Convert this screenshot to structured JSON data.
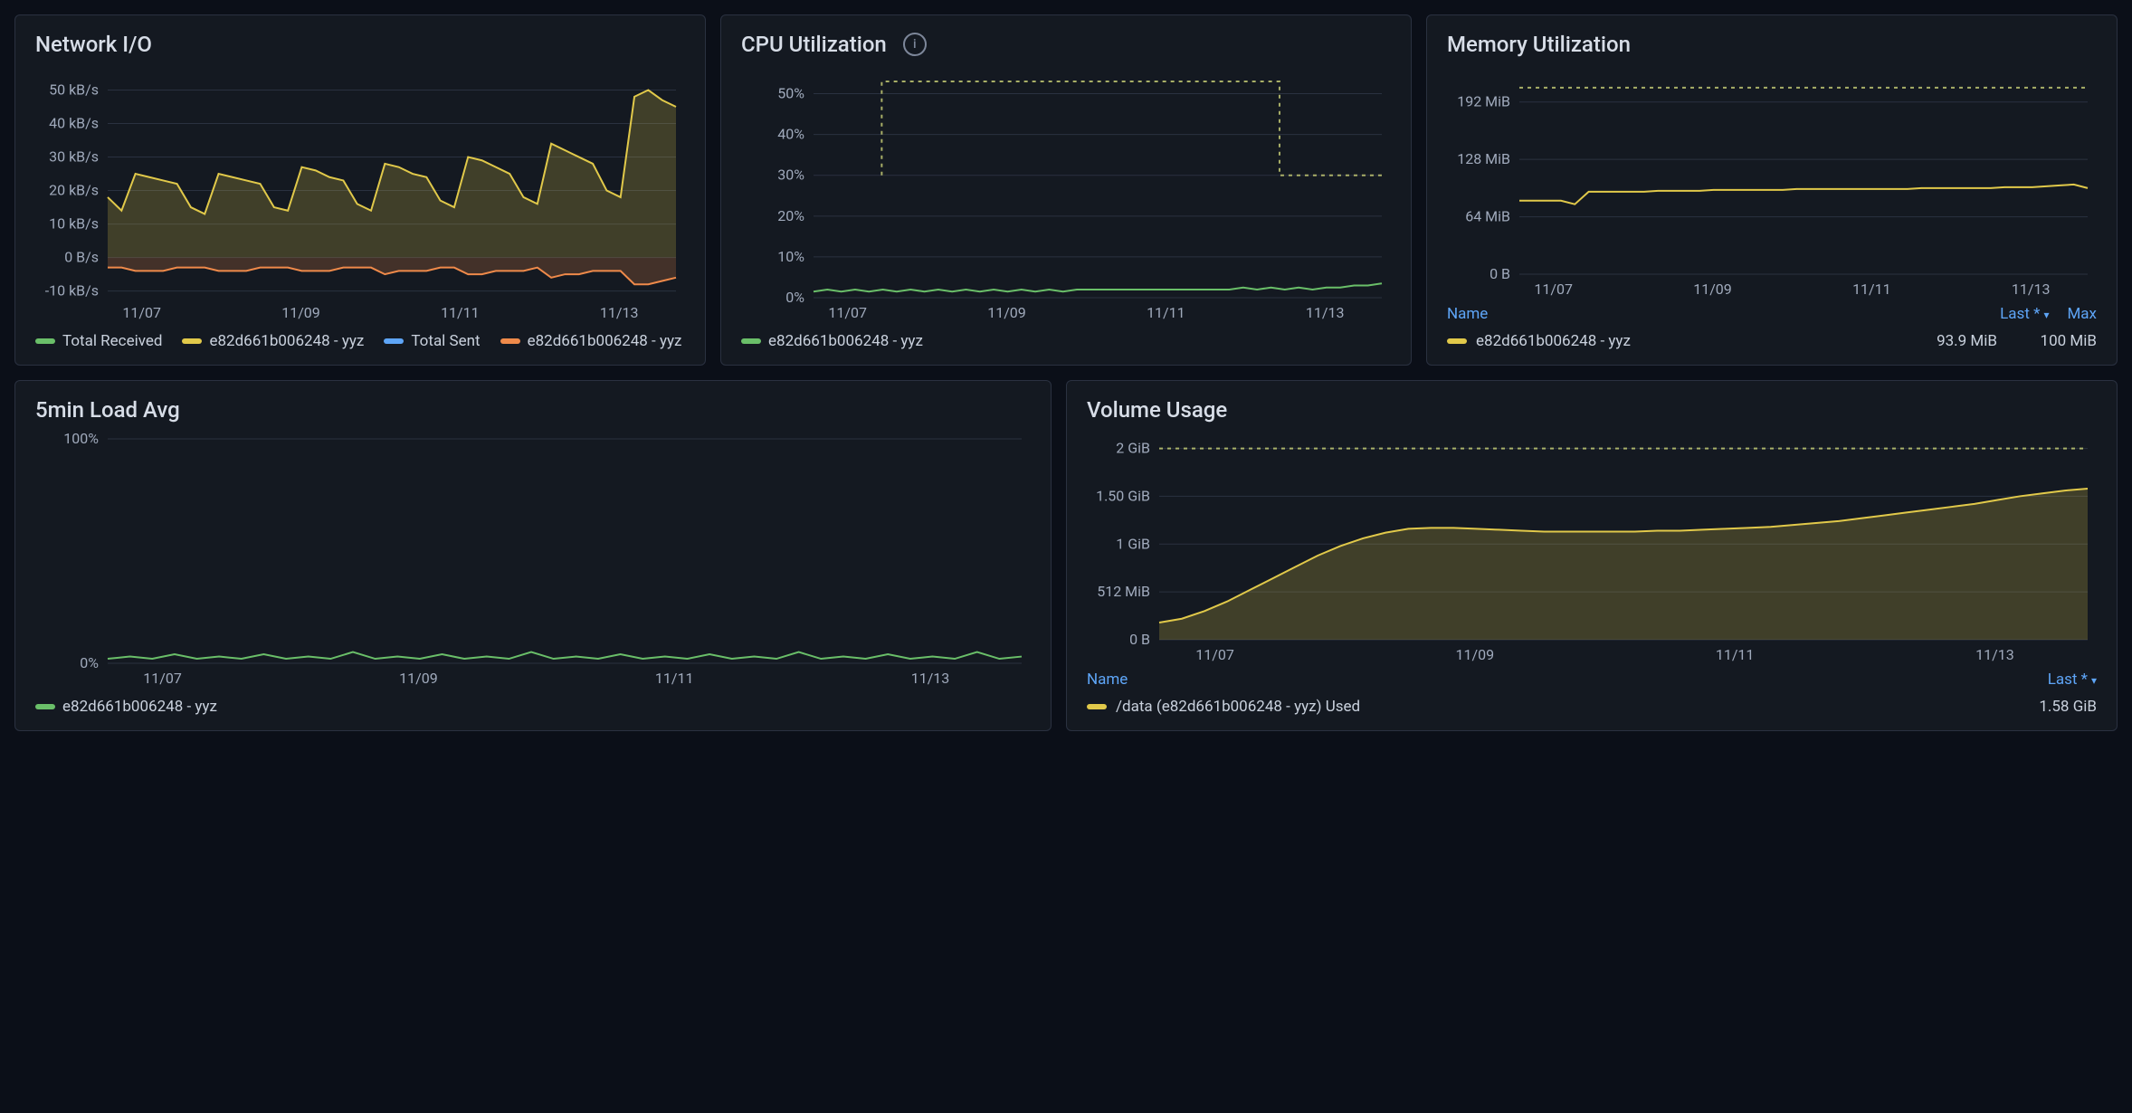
{
  "instance_id": "e82d661b006248 - yyz",
  "x_ticks": [
    "11/07",
    "11/09",
    "11/11",
    "11/13"
  ],
  "network": {
    "title": "Network I/O",
    "y_ticks": [
      "-10 kB/s",
      "0 B/s",
      "10 kB/s",
      "20 kB/s",
      "30 kB/s",
      "40 kB/s",
      "50 kB/s"
    ],
    "legend": {
      "total_received": "Total Received",
      "recv_inst": "e82d661b006248 - yyz",
      "total_sent": "Total Sent",
      "sent_inst": "e82d661b006248 - yyz"
    }
  },
  "cpu": {
    "title": "CPU Utilization",
    "y_ticks": [
      "0%",
      "10%",
      "20%",
      "30%",
      "40%",
      "50%"
    ],
    "legend_inst": "e82d661b006248 - yyz"
  },
  "memory": {
    "title": "Memory Utilization",
    "y_ticks": [
      "0 B",
      "64 MiB",
      "128 MiB",
      "192 MiB"
    ],
    "table": {
      "name_h": "Name",
      "last_h": "Last *",
      "max_h": "Max",
      "row_name": "e82d661b006248 - yyz",
      "last": "93.9 MiB",
      "max": "100 MiB"
    }
  },
  "load": {
    "title": "5min Load Avg",
    "y_ticks": [
      "0%",
      "100%"
    ],
    "legend_inst": "e82d661b006248 - yyz"
  },
  "volume": {
    "title": "Volume Usage",
    "y_ticks": [
      "0 B",
      "512 MiB",
      "1 GiB",
      "1.50 GiB",
      "2 GiB"
    ],
    "table": {
      "name_h": "Name",
      "last_h": "Last *",
      "row_name": "/data (e82d661b006248 - yyz) Used",
      "last": "1.58 GiB"
    }
  },
  "chart_data": [
    {
      "type": "area",
      "title": "Network I/O",
      "xlabel": "",
      "ylabel": "",
      "x_ticks": [
        "11/07",
        "11/09",
        "11/11",
        "11/13"
      ],
      "ylim_kBps": [
        -12,
        55
      ],
      "series": [
        {
          "name": "Total Received (e82d661b006248 - yyz)",
          "color": "#e1c94a",
          "unit": "kB/s",
          "values": [
            18,
            14,
            25,
            24,
            23,
            22,
            15,
            13,
            25,
            24,
            23,
            22,
            15,
            14,
            27,
            26,
            24,
            23,
            16,
            14,
            28,
            27,
            25,
            24,
            17,
            15,
            30,
            29,
            27,
            25,
            18,
            16,
            34,
            32,
            30,
            28,
            20,
            18,
            48,
            50,
            47,
            45
          ]
        },
        {
          "name": "Total Sent (e82d661b006248 - yyz)",
          "color": "#ef8a4a",
          "unit": "kB/s",
          "values": [
            -3,
            -3,
            -4,
            -4,
            -4,
            -3,
            -3,
            -3,
            -4,
            -4,
            -4,
            -3,
            -3,
            -3,
            -4,
            -4,
            -4,
            -3,
            -3,
            -3,
            -5,
            -4,
            -4,
            -4,
            -3,
            -3,
            -5,
            -5,
            -4,
            -4,
            -4,
            -3,
            -6,
            -5,
            -5,
            -4,
            -4,
            -4,
            -8,
            -8,
            -7,
            -6
          ]
        }
      ]
    },
    {
      "type": "line",
      "title": "CPU Utilization",
      "xlabel": "",
      "ylabel": "%",
      "x_ticks": [
        "11/07",
        "11/09",
        "11/11",
        "11/13"
      ],
      "ylim": [
        0,
        55
      ],
      "series": [
        {
          "name": "e82d661b006248 - yyz",
          "color": "#6abf69",
          "unit": "%",
          "values": [
            1.5,
            2,
            1.5,
            2,
            1.5,
            2,
            1.5,
            2,
            1.5,
            2,
            1.5,
            2,
            1.5,
            2,
            1.5,
            2,
            1.5,
            2,
            1.5,
            2,
            2,
            2,
            2,
            2,
            2,
            2,
            2,
            2,
            2,
            2,
            2,
            2.5,
            2,
            2.5,
            2,
            2.5,
            2,
            2.5,
            2.5,
            3,
            3,
            3.5
          ]
        }
      ],
      "annotations": [
        {
          "kind": "threshold-step",
          "y_before": 53,
          "y_after": 30,
          "x_change_frac": 0.82,
          "x_start_frac": 0.12
        }
      ]
    },
    {
      "type": "line",
      "title": "Memory Utilization",
      "xlabel": "",
      "ylabel": "MiB",
      "x_ticks": [
        "11/07",
        "11/09",
        "11/11",
        "11/13"
      ],
      "ylim": [
        0,
        224
      ],
      "series": [
        {
          "name": "e82d661b006248 - yyz",
          "color": "#e1c94a",
          "unit": "MiB",
          "values": [
            82,
            82,
            82,
            82,
            78,
            92,
            92,
            92,
            92,
            92,
            93,
            93,
            93,
            93,
            94,
            94,
            94,
            94,
            94,
            94,
            95,
            95,
            95,
            95,
            95,
            95,
            95,
            95,
            95,
            96,
            96,
            96,
            96,
            96,
            96,
            97,
            97,
            97,
            98,
            99,
            100,
            96
          ]
        }
      ],
      "annotations": [
        {
          "kind": "dotted-hline",
          "y": 208
        }
      ],
      "summary": {
        "last": "93.9 MiB",
        "max": "100 MiB"
      }
    },
    {
      "type": "line",
      "title": "5min Load Avg",
      "xlabel": "",
      "ylabel": "%",
      "x_ticks": [
        "11/07",
        "11/09",
        "11/11",
        "11/13"
      ],
      "ylim": [
        0,
        100
      ],
      "series": [
        {
          "name": "e82d661b006248 - yyz",
          "color": "#6abf69",
          "unit": "%",
          "values": [
            2,
            3,
            2,
            4,
            2,
            3,
            2,
            4,
            2,
            3,
            2,
            5,
            2,
            3,
            2,
            4,
            2,
            3,
            2,
            5,
            2,
            3,
            2,
            4,
            2,
            3,
            2,
            4,
            2,
            3,
            2,
            5,
            2,
            3,
            2,
            4,
            2,
            3,
            2,
            5,
            2,
            3
          ]
        }
      ]
    },
    {
      "type": "area",
      "title": "Volume Usage",
      "xlabel": "",
      "ylabel": "",
      "x_ticks": [
        "11/07",
        "11/09",
        "11/11",
        "11/13"
      ],
      "ylim_GiB": [
        0,
        2.1
      ],
      "series": [
        {
          "name": "/data (e82d661b006248 - yyz) Used",
          "color": "#e1c94a",
          "unit": "GiB",
          "values": [
            0.18,
            0.22,
            0.3,
            0.4,
            0.52,
            0.64,
            0.76,
            0.88,
            0.98,
            1.06,
            1.12,
            1.16,
            1.17,
            1.17,
            1.16,
            1.15,
            1.14,
            1.13,
            1.13,
            1.13,
            1.13,
            1.13,
            1.14,
            1.14,
            1.15,
            1.16,
            1.17,
            1.18,
            1.2,
            1.22,
            1.24,
            1.27,
            1.3,
            1.33,
            1.36,
            1.39,
            1.42,
            1.46,
            1.5,
            1.53,
            1.56,
            1.58
          ]
        }
      ],
      "annotations": [
        {
          "kind": "dotted-hline",
          "y": 2.0
        }
      ],
      "summary": {
        "last": "1.58 GiB"
      }
    }
  ]
}
